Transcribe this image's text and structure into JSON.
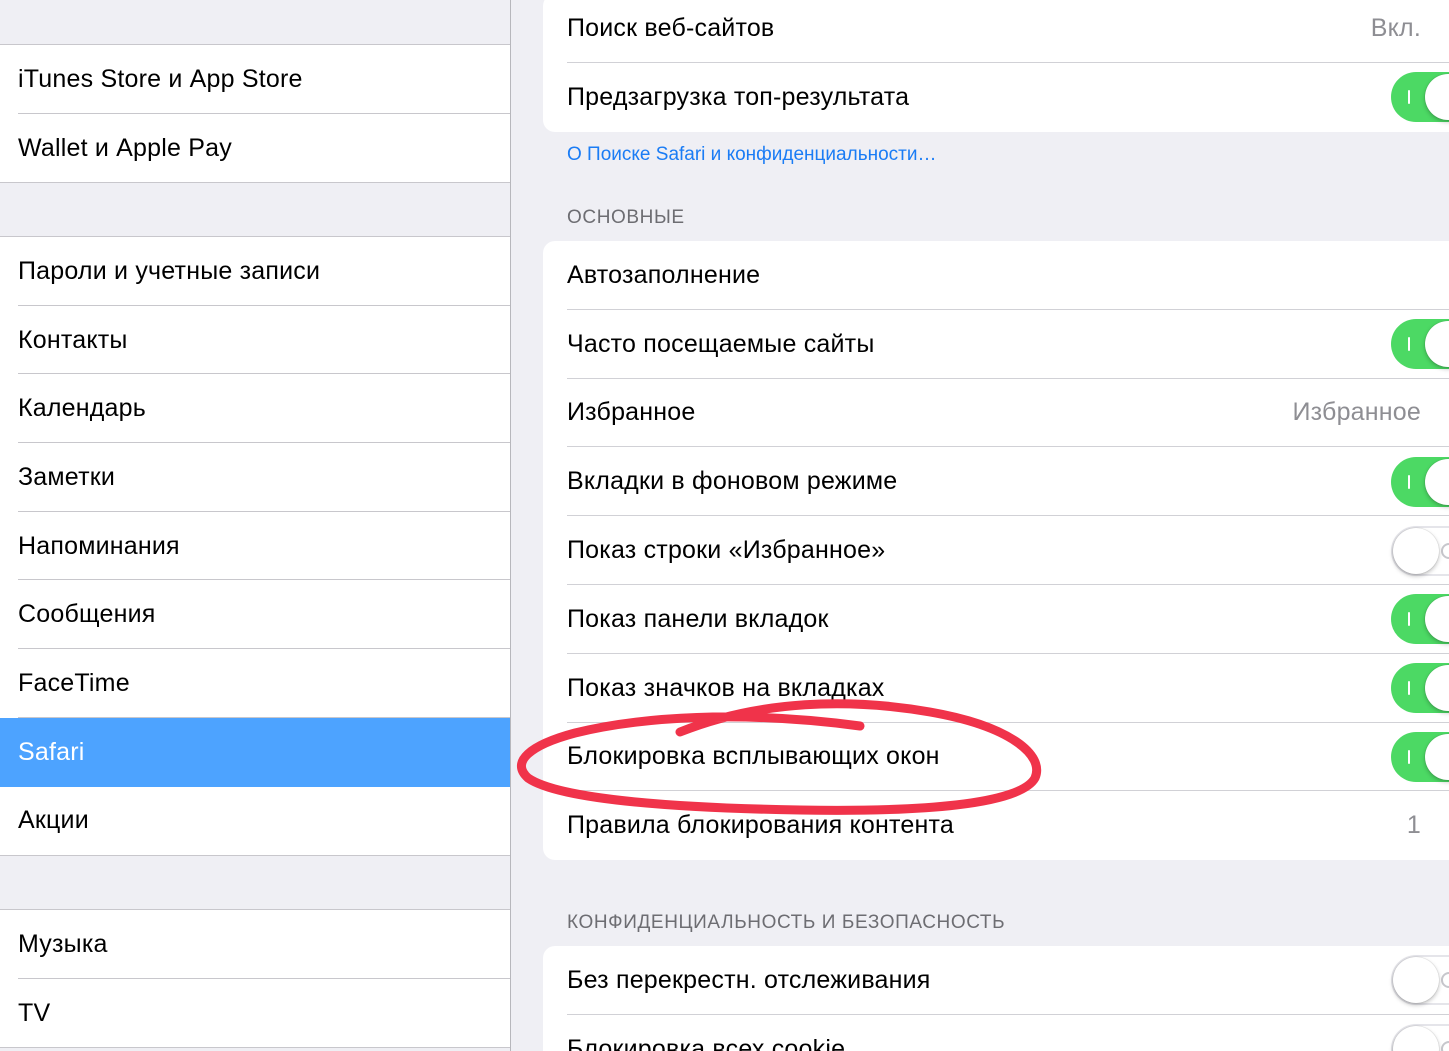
{
  "sidebar": {
    "groups": [
      {
        "items": [
          {
            "label": "iTunes Store и App Store"
          },
          {
            "label": "Wallet и Apple Pay"
          }
        ]
      },
      {
        "items": [
          {
            "label": "Пароли и учетные записи"
          },
          {
            "label": "Контакты"
          },
          {
            "label": "Календарь"
          },
          {
            "label": "Заметки"
          },
          {
            "label": "Напоминания"
          },
          {
            "label": "Сообщения"
          },
          {
            "label": "FaceTime"
          },
          {
            "label": "Safari",
            "selected": true
          },
          {
            "label": "Акции"
          }
        ]
      },
      {
        "items": [
          {
            "label": "Музыка"
          },
          {
            "label": "TV"
          }
        ]
      }
    ],
    "selected_color": "#4da3ff"
  },
  "search": {
    "rows": [
      {
        "label": "Поиск веб-сайтов",
        "value": "Вкл."
      },
      {
        "label": "Предзагрузка топ-результата",
        "toggle": true
      }
    ],
    "about_link": "О Поиске Safari и конфиденциальности…"
  },
  "general": {
    "header": "ОСНОВНЫЕ",
    "rows": [
      {
        "label": "Автозаполнение"
      },
      {
        "label": "Часто посещаемые сайты",
        "toggle": true
      },
      {
        "label": "Избранное",
        "value": "Избранное"
      },
      {
        "label": "Вкладки в фоновом режиме",
        "toggle": true
      },
      {
        "label": "Показ строки «Избранное»",
        "toggle": false
      },
      {
        "label": "Показ панели вкладок",
        "toggle": true
      },
      {
        "label": "Показ значков на вкладках",
        "toggle": true
      },
      {
        "label": "Блокировка всплывающих окон",
        "toggle": true
      },
      {
        "label": "Правила блокирования контента",
        "value": "1"
      }
    ]
  },
  "privacy": {
    "header": "КОНФИДЕНЦИАЛЬНОСТЬ И БЕЗОПАСНОСТЬ",
    "rows": [
      {
        "label": "Без перекрестн. отслеживания",
        "toggle": false
      },
      {
        "label": "Блокировка всех cookie",
        "toggle": false
      }
    ]
  },
  "colors": {
    "toggle_on": "#4cd964",
    "link": "#1a7cf5",
    "annotation": "#f0334a"
  }
}
